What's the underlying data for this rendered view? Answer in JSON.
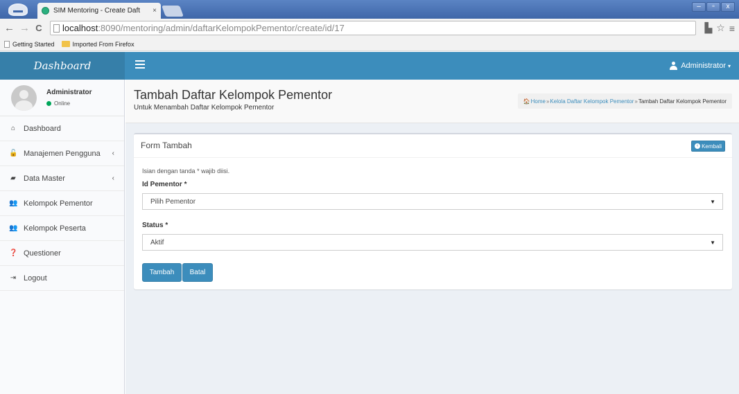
{
  "browser": {
    "tab_title": "SIM Mentoring - Create Daft",
    "tab_close": "×",
    "win_minimize": "–",
    "win_maximize": "▫",
    "win_close": "x",
    "nav_back": "←",
    "nav_forward": "→",
    "nav_reload": "C",
    "url_host": "localhost",
    "url_path": ":8090/mentoring/admin/daftarKelompokPementor/create/id/17",
    "extension_icon": "▙",
    "star_icon": "☆",
    "menu_icon": "≡",
    "bookmarks": [
      "Getting Started",
      "Imported From Firefox"
    ]
  },
  "header": {
    "logo": "Dashboard",
    "user_name": "Administrator",
    "caret": "▾",
    "color": "#3c8dbc",
    "logo_color": "#367fa9"
  },
  "sidebar": {
    "user": {
      "name": "Administrator",
      "status": "Online"
    },
    "items": [
      {
        "label": "Dashboard",
        "icon": "home-icon",
        "glyph": "⌂",
        "chevron": ""
      },
      {
        "label": "Manajemen Pengguna",
        "icon": "lock-icon",
        "glyph": "🔓",
        "chevron": "‹"
      },
      {
        "label": "Data Master",
        "icon": "book-icon",
        "glyph": "▰",
        "chevron": "‹"
      },
      {
        "label": "Kelompok Pementor",
        "icon": "users-icon",
        "glyph": "👥",
        "chevron": ""
      },
      {
        "label": "Kelompok Peserta",
        "icon": "users-icon",
        "glyph": "👥",
        "chevron": ""
      },
      {
        "label": "Questioner",
        "icon": "question-icon",
        "glyph": "❓",
        "chevron": ""
      },
      {
        "label": "Logout",
        "icon": "sign-out-icon",
        "glyph": "⇥",
        "chevron": ""
      }
    ]
  },
  "content": {
    "title": "Tambah Daftar Kelompok Pementor",
    "subtitle": "Untuk Menambah Daftar Kelompok Pementor",
    "breadcrumb": {
      "home": "Home",
      "level2": "Kelola Daftar Kelompok Pementor",
      "current": "Tambah Daftar Kelompok Pementor",
      "separator": "»",
      "home_icon": "🏠"
    },
    "form": {
      "title": "Form Tambah",
      "back_button": "Kembali",
      "back_icon": "‹",
      "hint": "Isian dengan tanda * wajib diisi.",
      "pementor_label": "Id Pementor *",
      "pementor_value": "Pilih Pementor",
      "status_label": "Status *",
      "status_value": "Aktif",
      "select_arrow": "▼",
      "submit": "Tambah",
      "cancel": "Batal"
    }
  }
}
